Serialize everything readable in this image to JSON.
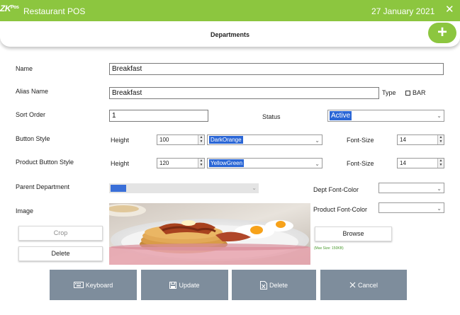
{
  "titlebar": {
    "logo_main": "ZK",
    "logo_sub": "Pos",
    "title": "Restaurant POS",
    "date": "27 January 2021",
    "close_icon": "close-icon",
    "background_color": "#8cc63f"
  },
  "header": {
    "title": "Departments",
    "add_label": "+"
  },
  "form": {
    "name_label": "Name",
    "name_value": "Breakfast",
    "alias_label": "Alias Name",
    "alias_value": "Breakfast",
    "type_label": "Type",
    "bar_label": "BAR",
    "bar_checked": false,
    "sort_label": "Sort Order",
    "sort_value": "1",
    "status_label": "Status",
    "status_value": "Active",
    "button_style_label": "Button Style",
    "height_label": "Height",
    "button_height": "100",
    "button_color": "DarkOrange",
    "font_size_label": "Font-Size",
    "button_font_size": "14",
    "product_button_style_label": "Product Button Style",
    "product_height": "120",
    "product_color": "YellowGreen",
    "product_font_size": "14",
    "parent_label": "Parent Department",
    "dept_font_color_label": "Dept Font-Color",
    "dept_font_color_value": "",
    "product_font_color_label": "Product Font-Color",
    "product_font_color_value": "",
    "image_label": "Image",
    "crop_label": "Crop",
    "delete_image_label": "Delete",
    "browse_label": "Browse",
    "max_size_hint": "(Max Size: 150KB)"
  },
  "actions": {
    "keyboard_label": "Keyboard",
    "update_label": "Update",
    "delete_label": "Delete",
    "cancel_label": "Cancel",
    "button_color": "#7e8d9c"
  }
}
